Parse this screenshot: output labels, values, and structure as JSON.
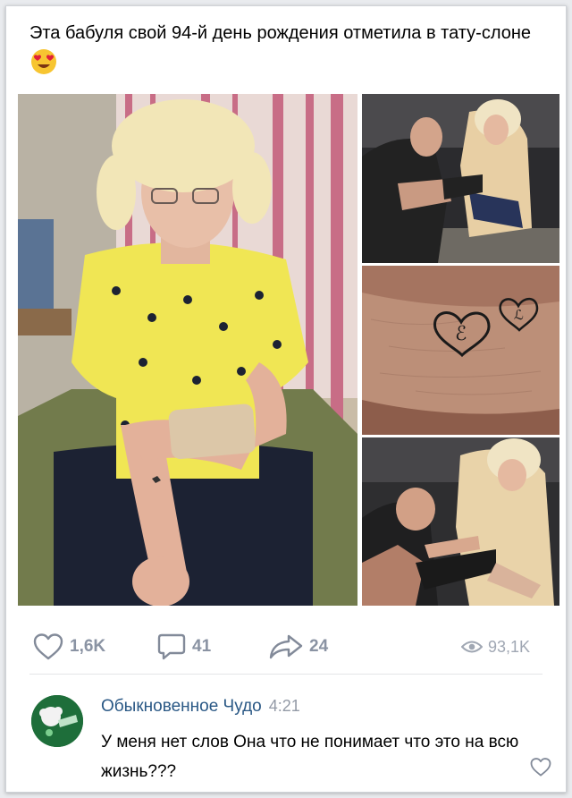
{
  "post": {
    "text": "Эта бабуля свой 94-й день рождения отметила в тату-слоне",
    "emoji": "heart-eyes-emoji"
  },
  "photos": {
    "main": "elderly woman in yellow blouse showing arm tattoo",
    "top": "tattoo artist working on woman's arm",
    "mid": "close-up of two small heart tattoos",
    "bottom": "tattoo artist tattooing woman"
  },
  "actions": {
    "likes": "1,6K",
    "comments": "41",
    "shares": "24",
    "views": "93,1K"
  },
  "comment": {
    "author": "Обыкновенное Чудо",
    "time": "4:21",
    "text": "У меня нет слов  Она что не понимает что это на всю жизнь???"
  },
  "colors": {
    "link": "#2a5885",
    "icon": "#828a99",
    "background": "#e9ebee"
  }
}
